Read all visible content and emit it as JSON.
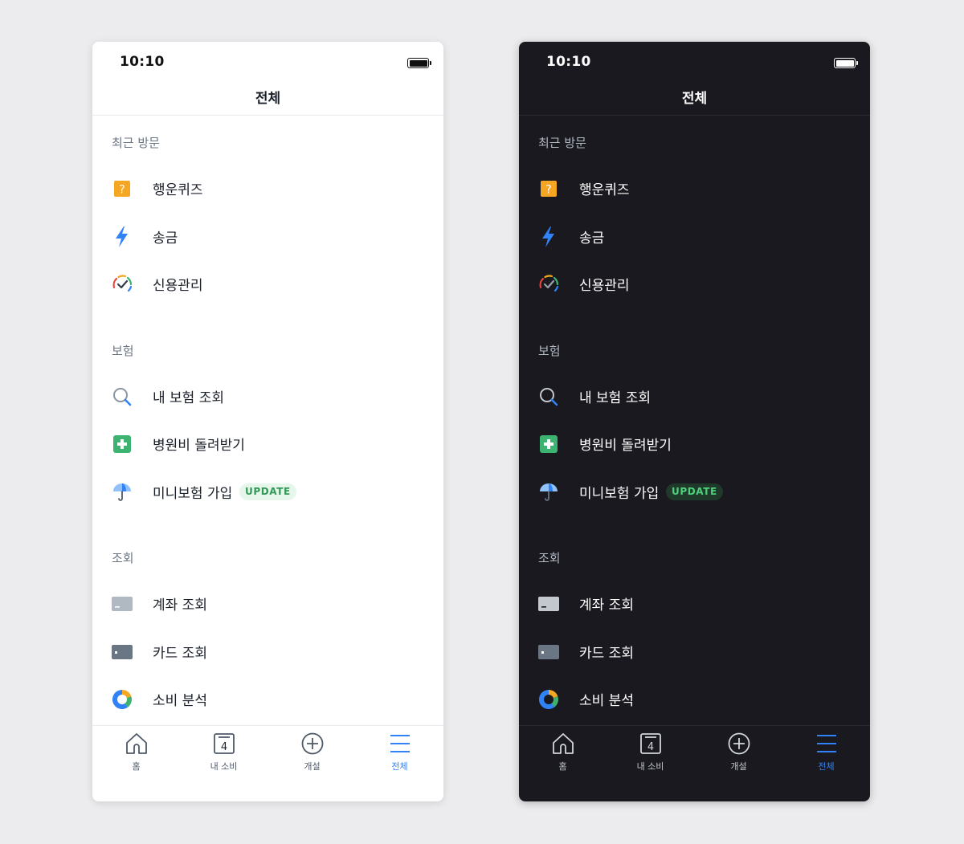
{
  "status_bar": {
    "time": "10:10"
  },
  "header": {
    "title": "전체"
  },
  "sections": {
    "recent": {
      "title": "최근 방문",
      "items": [
        {
          "label": "행운퀴즈",
          "icon": "quiz-icon"
        },
        {
          "label": "송금",
          "icon": "lightning-icon"
        },
        {
          "label": "신용관리",
          "icon": "credit-check-icon"
        }
      ]
    },
    "insurance": {
      "title": "보험",
      "items": [
        {
          "label": "내 보험 조회",
          "icon": "search-icon"
        },
        {
          "label": "병원비 돌려받기",
          "icon": "medical-cross-icon"
        },
        {
          "label": "미니보험 가입",
          "icon": "umbrella-icon",
          "badge": "UPDATE"
        }
      ]
    },
    "inquiry": {
      "title": "조회",
      "items": [
        {
          "label": "계좌 조회",
          "icon": "account-card-icon"
        },
        {
          "label": "카드 조회",
          "icon": "credit-card-icon"
        },
        {
          "label": "소비 분석",
          "icon": "donut-chart-icon"
        }
      ]
    }
  },
  "tab_bar": {
    "items": [
      {
        "label": "홈",
        "icon": "home-icon"
      },
      {
        "label": "내 소비",
        "icon": "calendar-icon",
        "icon_text": "4"
      },
      {
        "label": "개설",
        "icon": "plus-circle-icon"
      },
      {
        "label": "전체",
        "icon": "menu-icon",
        "active": true
      }
    ]
  },
  "themes": [
    "light",
    "dark"
  ],
  "colors": {
    "accent": "#3182f6",
    "quiz": "#f5a623",
    "medical": "#3cb371",
    "badge_light_bg": "#e6f6ea",
    "badge_light_fg": "#2e9a56",
    "dark_bg": "#19191f",
    "light_bg": "#ffffff"
  }
}
